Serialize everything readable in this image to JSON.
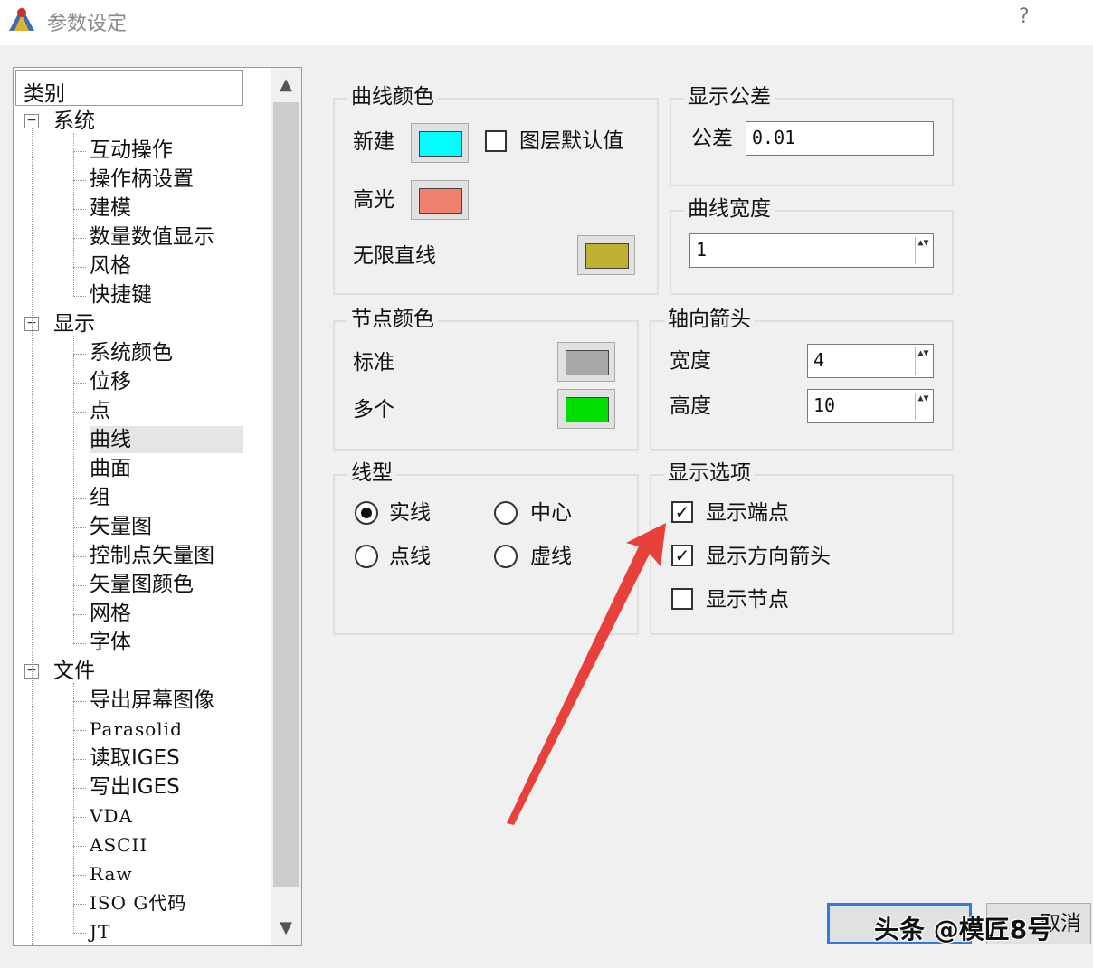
{
  "window": {
    "title": "参数设定",
    "help": "?"
  },
  "tree": {
    "header": "类别",
    "categories": [
      {
        "label": "系统",
        "expander": "−",
        "items": [
          "互动操作",
          "操作柄设置",
          "建模",
          "数量数值显示",
          "风格",
          "快捷键"
        ]
      },
      {
        "label": "显示",
        "expander": "−",
        "items": [
          "系统颜色",
          "位移",
          "点",
          "曲线",
          "曲面",
          "组",
          "矢量图",
          "控制点矢量图",
          "矢量图颜色",
          "网格",
          "字体"
        ]
      },
      {
        "label": "文件",
        "expander": "−",
        "items": [
          "导出屏幕图像",
          "Parasolid",
          "读取IGES",
          "写出IGES",
          "VDA",
          "ASCII",
          "Raw",
          "ISO G代码",
          "JT"
        ]
      }
    ],
    "selected": "曲线",
    "scroll_up": "▲",
    "scroll_down": "▼"
  },
  "curve_color": {
    "title": "曲线颜色",
    "new_label": "新建",
    "new_color": "#00ffff",
    "layer_default_label": "图层默认值",
    "layer_default_checked": false,
    "highlight_label": "高光",
    "highlight_color": "#f08070",
    "infinite_line_label": "无限直线",
    "infinite_line_color": "#c0b030"
  },
  "node_color": {
    "title": "节点颜色",
    "standard_label": "标准",
    "standard_color": "#a8a8a8",
    "multiple_label": "多个",
    "multiple_color": "#00e000"
  },
  "line_type": {
    "title": "线型",
    "options": [
      {
        "label": "实线",
        "selected": true
      },
      {
        "label": "中心",
        "selected": false
      },
      {
        "label": "点线",
        "selected": false
      },
      {
        "label": "虚线",
        "selected": false
      }
    ]
  },
  "tolerance": {
    "title": "显示公差",
    "label": "公差",
    "value": "0.01"
  },
  "curve_width": {
    "title": "曲线宽度",
    "value": "1"
  },
  "axis_arrow": {
    "title": "轴向箭头",
    "width_label": "宽度",
    "width_value": "4",
    "height_label": "高度",
    "height_value": "10"
  },
  "display_options": {
    "title": "显示选项",
    "items": [
      {
        "label": "显示端点",
        "checked": true
      },
      {
        "label": "显示方向箭头",
        "checked": true
      },
      {
        "label": "显示节点",
        "checked": false
      }
    ]
  },
  "buttons": {
    "cancel": "取消"
  },
  "watermark": "头条 @模匠8号",
  "annotation_arrow_color": "#e8403a",
  "spin_glyph": "▲▼",
  "check_glyph": "✓"
}
